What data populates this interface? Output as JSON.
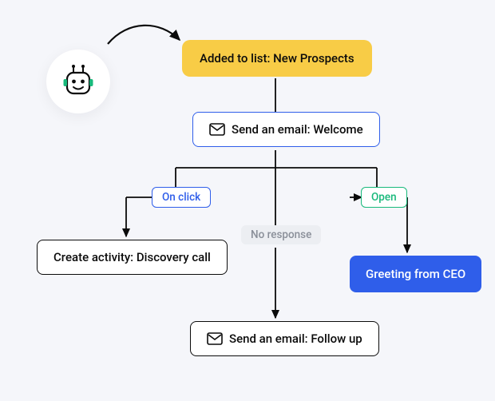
{
  "nodes": {
    "trigger": {
      "label": "Added to list: New Prospects"
    },
    "email_welcome": {
      "label": "Send an email: Welcome"
    },
    "create_activity": {
      "label": "Create activity: Discovery call"
    },
    "greeting": {
      "label": "Greeting from CEO"
    },
    "email_followup": {
      "label": "Send an email: Follow up"
    }
  },
  "conditions": {
    "on_click": {
      "label": "On click"
    },
    "open": {
      "label": "Open"
    },
    "no_response": {
      "label": "No response"
    }
  }
}
